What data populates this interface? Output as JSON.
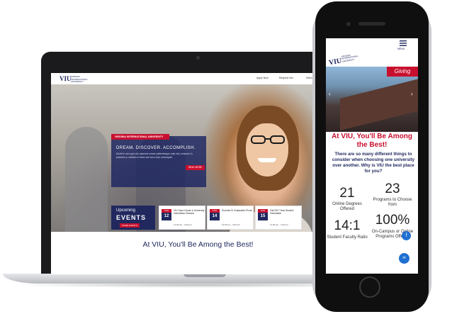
{
  "desktop": {
    "logo": {
      "mark": "VIU",
      "text": "VIRGINIA INTERNATIONAL UNIVERSITY"
    },
    "utility_links": [
      "Apply Now",
      "Request Info",
      "Select Language"
    ],
    "hero": {
      "tag": "VIRGINIA INTERNATIONAL UNIVERSITY",
      "headline": "DREAM. DISCOVER. ACCOMPLISH.",
      "body": "Morbi in sem quis dui placerat ornare pellentesque odio nisi, euismod in pharetra a, ultricies in diam sed arcu cras consequat.",
      "button": "READ MORE"
    },
    "events": {
      "upcoming": "Upcoming",
      "title": "EVENTS",
      "more": "MORE EVENTS",
      "items": [
        {
          "month": "AUG",
          "day": "12",
          "title": "VIU Open House & University Information Session",
          "time": "11:30 am - 2:30 pm"
        },
        {
          "month": "AUG",
          "day": "14",
          "title": "Summer III Graduation Picnic",
          "time": "12:00 pm - 3:00 pm"
        },
        {
          "month": "AUG",
          "day": "15",
          "title": "Fall 2017 New Student Orientation",
          "time": "11:00 am - 1:00 pm"
        }
      ]
    },
    "tagline": "At VIU, You'll Be Among the Best!"
  },
  "mobile": {
    "logo": {
      "mark": "VIU",
      "text": "VIRGINIA INTERNATIONAL UNIVERSITY"
    },
    "menu_label": "MENU",
    "giving": "Giving",
    "headline": "At VIU, You'll Be Among the Best!",
    "intro": "There are so many different things to consider when choosing one university over another. Why is VIU the best place for you?",
    "stats": [
      {
        "value": "21",
        "label": "Online Degrees Offered"
      },
      {
        "value": "23",
        "label": "Programs to Choose from"
      },
      {
        "value": "14:1",
        "label": "Student Faculty Ratio"
      },
      {
        "value": "100%",
        "label": "On-Campus or Online Programs Offered"
      }
    ],
    "fab_icons": [
      "facebook-icon",
      "chat-icon"
    ]
  },
  "colors": {
    "navy": "#20285e",
    "red": "#c8102e",
    "blue": "#1f6fd1"
  }
}
